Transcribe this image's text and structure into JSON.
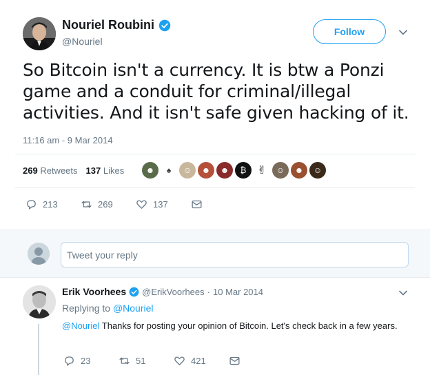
{
  "tweet": {
    "author_name": "Nouriel Roubini",
    "author_handle": "@Nouriel",
    "follow_label": "Follow",
    "text": "So Bitcoin isn't a currency. It is btw a Ponzi game and a conduit for criminal/illegal activities. And it isn't safe given hacking of it.",
    "timestamp": "11:16 am - 9 Mar 2014",
    "retweets_count": "269",
    "retweets_label": "Retweets",
    "likes_count": "137",
    "likes_label": "Likes",
    "actions": {
      "replies": "213",
      "retweets": "269",
      "likes": "137"
    }
  },
  "reply_box": {
    "placeholder": "Tweet your reply"
  },
  "reply": {
    "author_name": "Erik Voorhees",
    "author_handle": "@ErikVoorhees",
    "separator": "·",
    "date": "10 Mar 2014",
    "replying_to_label": "Replying to",
    "replying_to_handle": "@Nouriel",
    "mention": "@Nouriel",
    "text": " Thanks for posting your opinion of Bitcoin. Let's check back in a few years.",
    "actions": {
      "replies": "23",
      "retweets": "51",
      "likes": "421"
    }
  },
  "colors": {
    "accent": "#1da1f2",
    "text": "#14171a",
    "muted": "#657786"
  }
}
